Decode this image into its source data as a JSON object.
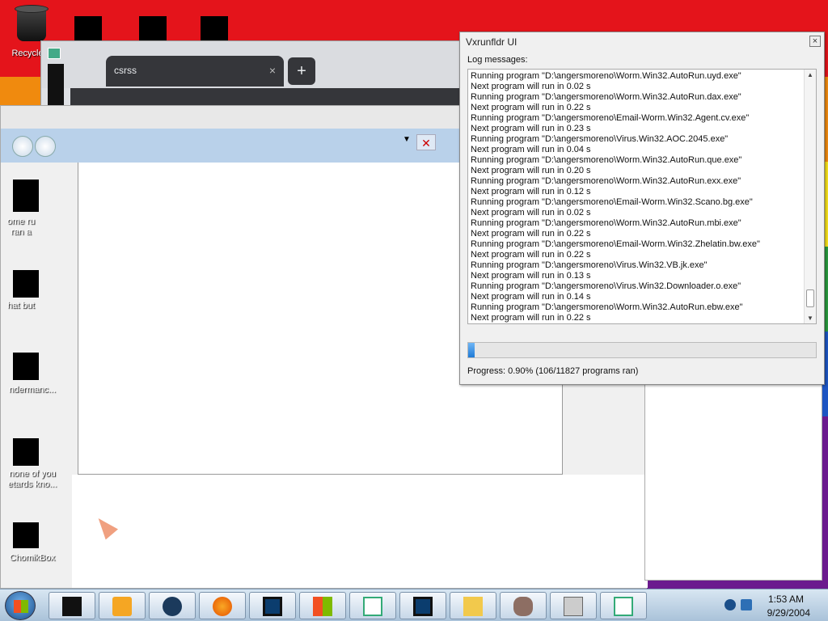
{
  "desktop": {
    "icons": [
      {
        "label": "Recycle"
      },
      {
        "label": "ome ru\nran a"
      },
      {
        "label": "hat but"
      },
      {
        "label": "ndermanc..."
      },
      {
        "label": "none of you\netards kno..."
      },
      {
        "label": "ChomikBox"
      }
    ]
  },
  "browser": {
    "tab_title": "csrss",
    "tab_close": "×",
    "new_tab": "+"
  },
  "dialog": {
    "title": "Vxrunfldr UI",
    "close": "×",
    "log_label": "Log messages:",
    "log_lines": [
      "Running program \"D:\\angersmoreno\\Worm.Win32.AutoRun.uyd.exe\"",
      "Next program will run in 0.02 s",
      "Running program \"D:\\angersmoreno\\Worm.Win32.AutoRun.dax.exe\"",
      "Next program will run in 0.22 s",
      "Running program \"D:\\angersmoreno\\Email-Worm.Win32.Agent.cv.exe\"",
      "Next program will run in 0.23 s",
      "Running program \"D:\\angersmoreno\\Virus.Win32.AOC.2045.exe\"",
      "Next program will run in 0.04 s",
      "Running program \"D:\\angersmoreno\\Worm.Win32.AutoRun.que.exe\"",
      "Next program will run in 0.20 s",
      "Running program \"D:\\angersmoreno\\Worm.Win32.AutoRun.exx.exe\"",
      "Next program will run in 0.12 s",
      "Running program \"D:\\angersmoreno\\Email-Worm.Win32.Scano.bg.exe\"",
      "Next program will run in 0.02 s",
      "Running program \"D:\\angersmoreno\\Worm.Win32.AutoRun.mbi.exe\"",
      "Next program will run in 0.22 s",
      "Running program \"D:\\angersmoreno\\Email-Worm.Win32.Zhelatin.bw.exe\"",
      "Next program will run in 0.22 s",
      "Running program \"D:\\angersmoreno\\Virus.Win32.VB.jk.exe\"",
      "Next program will run in 0.13 s",
      "Running program \"D:\\angersmoreno\\Virus.Win32.Downloader.o.exe\"",
      "Next program will run in 0.14 s",
      "Running program \"D:\\angersmoreno\\Worm.Win32.AutoRun.ebw.exe\"",
      "Next program will run in 0.22 s"
    ],
    "progress_fraction": 0.009,
    "progress_text": "Progress: 0.90% (106/11827 programs ran)"
  },
  "taskbar": {
    "time": "1:53 AM",
    "date": "9/29/2004"
  },
  "colors": {
    "progress_fill": "#1f7ad6",
    "taskbar": "#c7d7e8",
    "nav": "#b9d1ea"
  }
}
